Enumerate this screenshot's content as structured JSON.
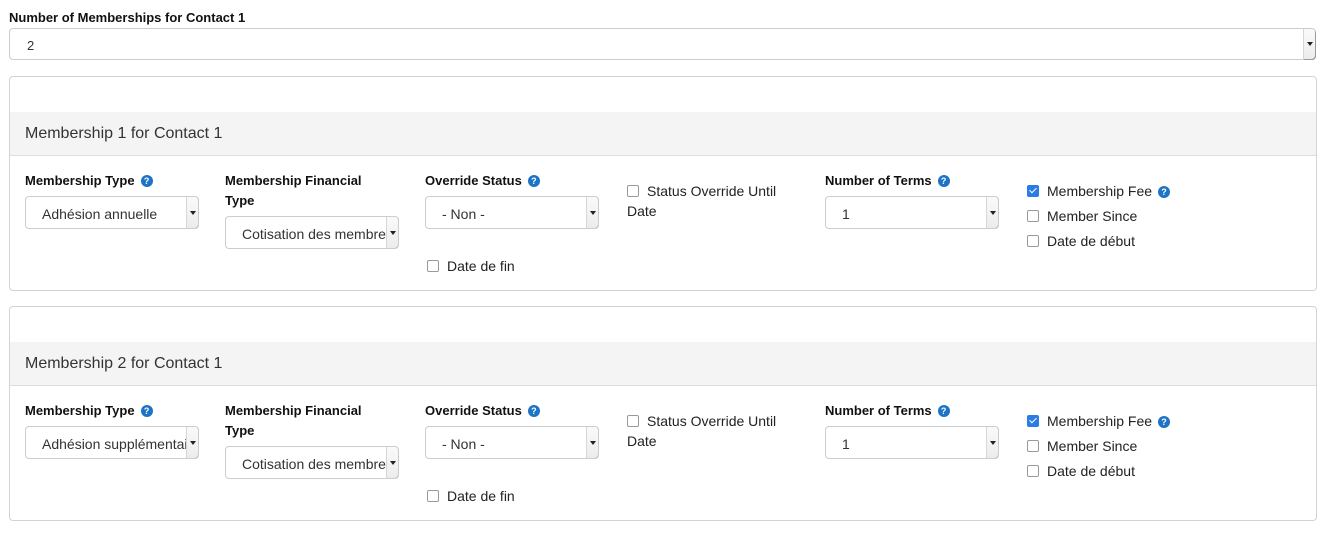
{
  "header": {
    "label": "Number of Memberships for Contact 1",
    "value": "2"
  },
  "memberships": [
    {
      "title": "Membership 1 for Contact 1",
      "membership_type": {
        "label": "Membership Type",
        "value": "Adhésion annuelle"
      },
      "financial_type": {
        "label": "Membership Financial Type",
        "value": "Cotisation des membres"
      },
      "override_status": {
        "label": "Override Status",
        "value": "- Non -"
      },
      "status_override_until": {
        "label": "Status Override Until Date",
        "checked": false
      },
      "date_de_fin": {
        "label": "Date de fin",
        "checked": false
      },
      "number_of_terms": {
        "label": "Number of Terms",
        "value": "1"
      },
      "membership_fee": {
        "label": "Membership Fee",
        "checked": true
      },
      "member_since": {
        "label": "Member Since",
        "checked": false
      },
      "date_de_debut": {
        "label": "Date de début",
        "checked": false
      }
    },
    {
      "title": "Membership 2 for Contact 1",
      "membership_type": {
        "label": "Membership Type",
        "value": "Adhésion supplémentaire"
      },
      "financial_type": {
        "label": "Membership Financial Type",
        "value": "Cotisation des membres"
      },
      "override_status": {
        "label": "Override Status",
        "value": "- Non -"
      },
      "status_override_until": {
        "label": "Status Override Until Date",
        "checked": false
      },
      "date_de_fin": {
        "label": "Date de fin",
        "checked": false
      },
      "number_of_terms": {
        "label": "Number of Terms",
        "value": "1"
      },
      "membership_fee": {
        "label": "Membership Fee",
        "checked": true
      },
      "member_since": {
        "label": "Member Since",
        "checked": false
      },
      "date_de_debut": {
        "label": "Date de début",
        "checked": false
      }
    }
  ],
  "icons": {
    "help": "question-circle-icon",
    "dropdown": "caret-down-icon"
  },
  "colors": {
    "help_icon": "#1d73c4",
    "checkbox_checked": "#2d7be5",
    "panel_header_bg": "#f4f4f4"
  }
}
